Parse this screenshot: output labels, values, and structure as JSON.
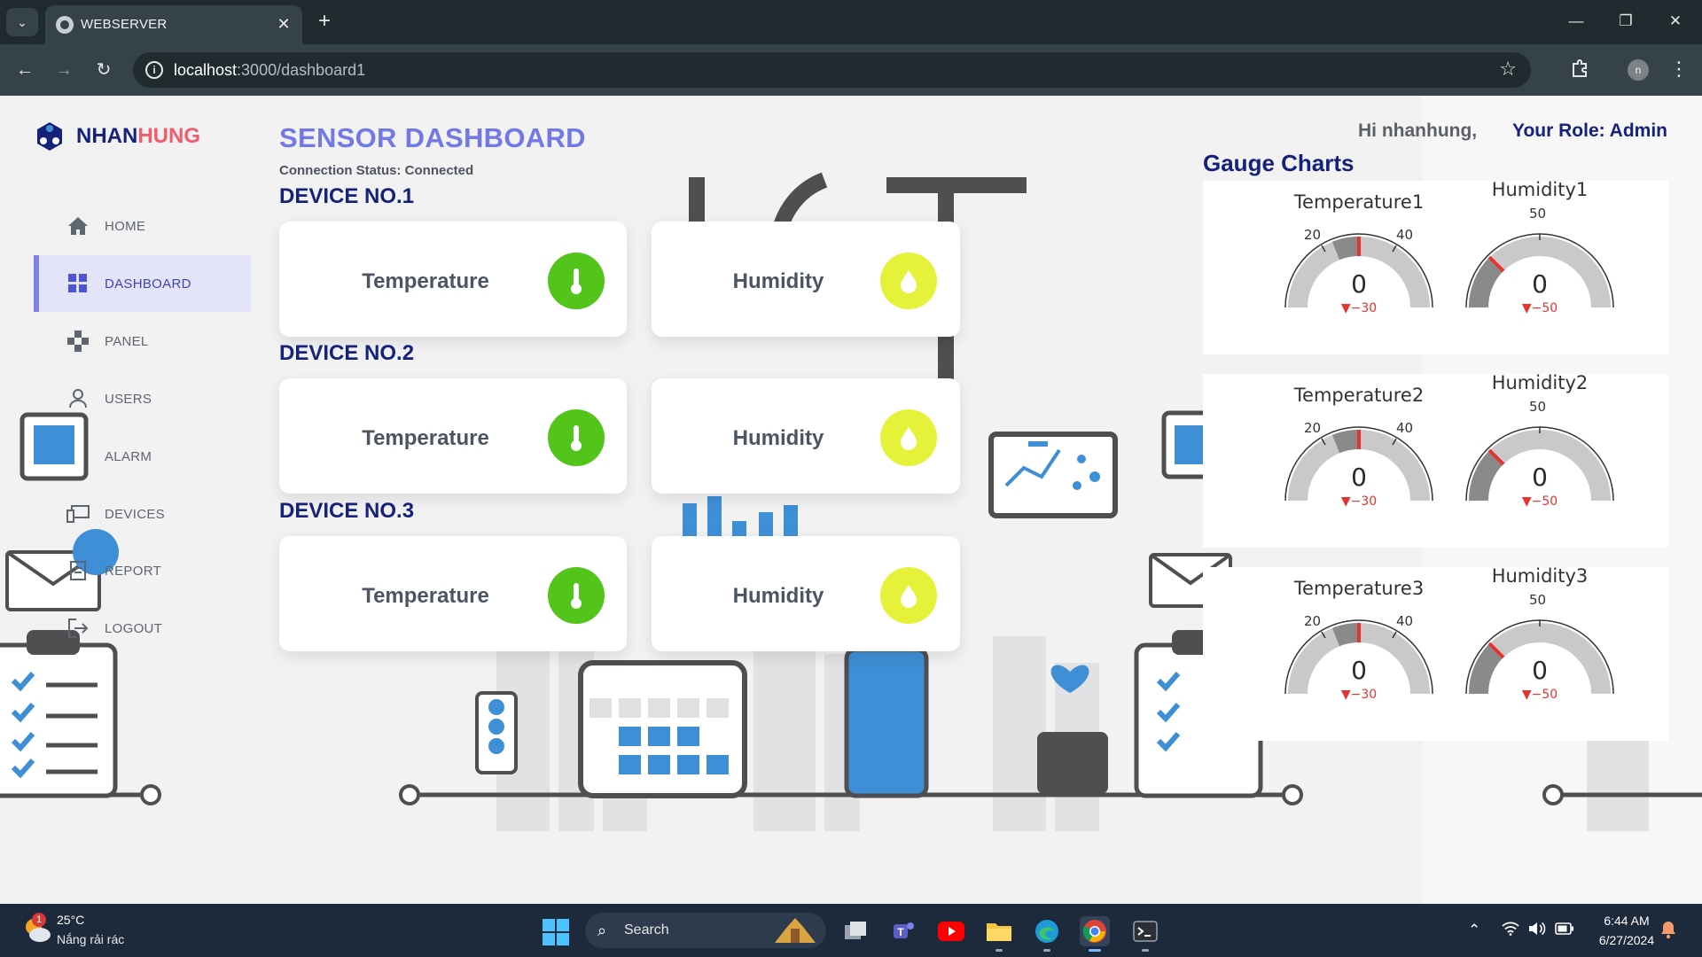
{
  "browser": {
    "tab_title": "WEBSERVER",
    "url_host": "localhost",
    "url_path": ":3000/dashboard1"
  },
  "sidebar": {
    "brand_part1": "NHAN",
    "brand_part2": "HUNG",
    "items": [
      {
        "label": "HOME",
        "icon": "home-icon"
      },
      {
        "label": "DASHBOARD",
        "icon": "grid-icon",
        "active": true
      },
      {
        "label": "PANEL",
        "icon": "panel-icon"
      },
      {
        "label": "USERS",
        "icon": "user-icon"
      },
      {
        "label": "ALARM",
        "icon": "alarm-icon"
      },
      {
        "label": "DEVICES",
        "icon": "devices-icon"
      },
      {
        "label": "REPORT",
        "icon": "report-icon"
      },
      {
        "label": "LOGOUT",
        "icon": "logout-icon"
      }
    ]
  },
  "main": {
    "title": "SENSOR DASHBOARD",
    "connection_status": "Connection Status: Connected",
    "devices": [
      {
        "title": "DEVICE NO.1",
        "temp_label": "Temperature",
        "hum_label": "Humidity"
      },
      {
        "title": "DEVICE NO.2",
        "temp_label": "Temperature",
        "hum_label": "Humidity"
      },
      {
        "title": "DEVICE NO.3",
        "temp_label": "Temperature",
        "hum_label": "Humidity"
      }
    ]
  },
  "header": {
    "greeting": "Hi nhanhung,",
    "role": "Your Role: Admin"
  },
  "gauges": {
    "title": "Gauge Charts",
    "rows": [
      {
        "temp": {
          "name": "Temperature1",
          "value": "0",
          "delta": "▼−30",
          "tick_low": "20",
          "tick_high": "40"
        },
        "hum": {
          "name": "Humidity1",
          "value": "0",
          "delta": "▼−50",
          "tick_mid": "50"
        }
      },
      {
        "temp": {
          "name": "Temperature2",
          "value": "0",
          "delta": "▼−30",
          "tick_low": "20",
          "tick_high": "40"
        },
        "hum": {
          "name": "Humidity2",
          "value": "0",
          "delta": "▼−50",
          "tick_mid": "50"
        }
      },
      {
        "temp": {
          "name": "Temperature3",
          "value": "0",
          "delta": "▼−30",
          "tick_low": "20",
          "tick_high": "40"
        },
        "hum": {
          "name": "Humidity3",
          "value": "0",
          "delta": "▼−50",
          "tick_mid": "50"
        }
      }
    ]
  },
  "taskbar": {
    "weather_badge": "1",
    "weather_temp": "25°C",
    "weather_desc": "Nắng rải rác",
    "search_label": "Search",
    "time": "6:44 AM",
    "date": "6/27/2024"
  },
  "colors": {
    "title_accent": "#7279e6",
    "navy": "#14227a",
    "temp_badge": "#52c41a",
    "hum_badge": "#e6f23a",
    "gauge_threshold": "#e8322e"
  }
}
